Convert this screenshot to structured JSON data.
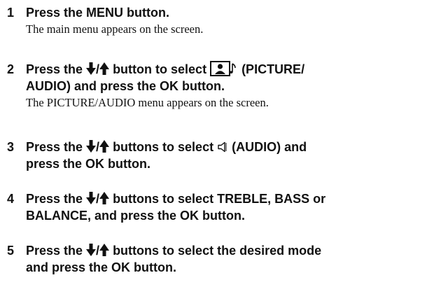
{
  "steps": [
    {
      "number": "1",
      "segments": [
        "Press the MENU button."
      ],
      "result": "The main menu appears on the screen."
    },
    {
      "number": "2",
      "segments": [
        "Press the ",
        "/",
        " button to select ",
        " (PICTURE/",
        "AUDIO) and press the OK button."
      ],
      "result": "The PICTURE/AUDIO menu appears on the screen."
    },
    {
      "number": "3",
      "segments": [
        "Press the ",
        "/",
        " buttons to select ",
        " (AUDIO) and",
        "press the OK button."
      ]
    },
    {
      "number": "4",
      "segments": [
        "Press the ",
        "/",
        " buttons to select TREBLE, BASS or",
        "BALANCE, and press the OK button."
      ]
    },
    {
      "number": "5",
      "segments": [
        "Press the ",
        "/",
        " buttons to select the desired mode",
        "and press the OK button."
      ]
    }
  ],
  "icons": {
    "down_arrow": "down-arrow-icon",
    "up_arrow": "up-arrow-icon",
    "picture_audio": "picture-audio-icon",
    "audio": "speaker-icon"
  }
}
